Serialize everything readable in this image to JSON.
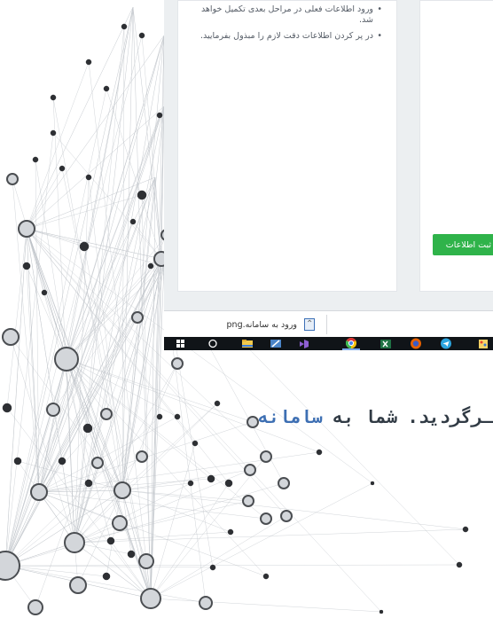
{
  "notes": {
    "items": [
      "ورود اطلاعات فعلی در مراحل بعدی تکمیل خواهد شد.",
      "در پر کردن اطلاعات دقت لازم را مبذول بفرمایید."
    ]
  },
  "register_button": {
    "label": "ثبت اطلاعات"
  },
  "download_bar": {
    "file_name": "ورود به سامانه.png"
  },
  "taskbar": {
    "icons": [
      "windows-start-icon",
      "cortana-search-icon",
      "file-explorer-icon",
      "snipping-tool-icon",
      "visual-studio-icon",
      "chrome-icon",
      "excel-icon",
      "firefox-icon",
      "telegram-icon",
      "paint-icon"
    ]
  },
  "caption": {
    "text_prefix": "ـرگردید. شما به ",
    "text_highlight": "سامانه"
  },
  "colors": {
    "accent_green": "#2fb34a",
    "highlight_blue": "#3d6fb3",
    "taskbar": "#101418"
  }
}
